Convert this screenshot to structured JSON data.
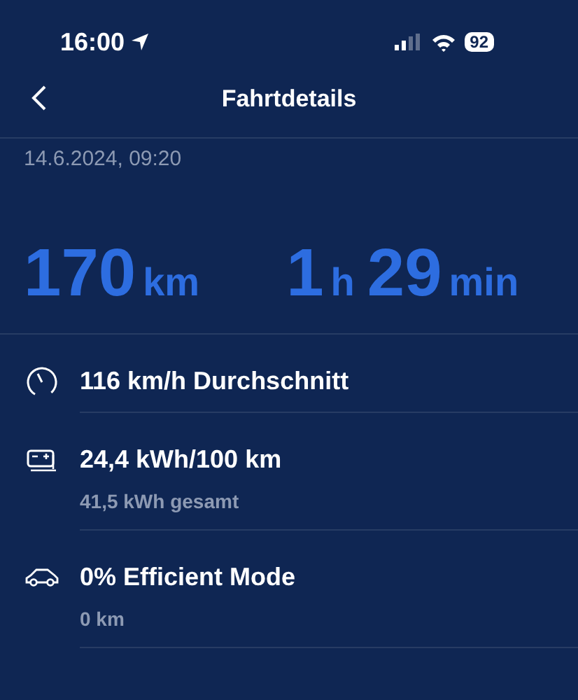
{
  "status_bar": {
    "time": "16:00",
    "battery": "92"
  },
  "header": {
    "title": "Fahrtdetails"
  },
  "date": "14.6.2024, 09:20",
  "totals": [
    {
      "parts": [
        {
          "value": "170",
          "unit": "km"
        }
      ]
    },
    {
      "parts": [
        {
          "value": "1",
          "unit": "h"
        },
        {
          "value": "29",
          "unit": "min"
        }
      ]
    }
  ],
  "stats": [
    {
      "kind": "speed",
      "title": "116 km/h Durchschnitt"
    },
    {
      "kind": "battery",
      "title": "24,4 kWh/100 km",
      "subtitle": "41,5 kWh gesamt"
    },
    {
      "kind": "car",
      "title": "0% Efficient Mode",
      "subtitle": "0 km"
    }
  ]
}
